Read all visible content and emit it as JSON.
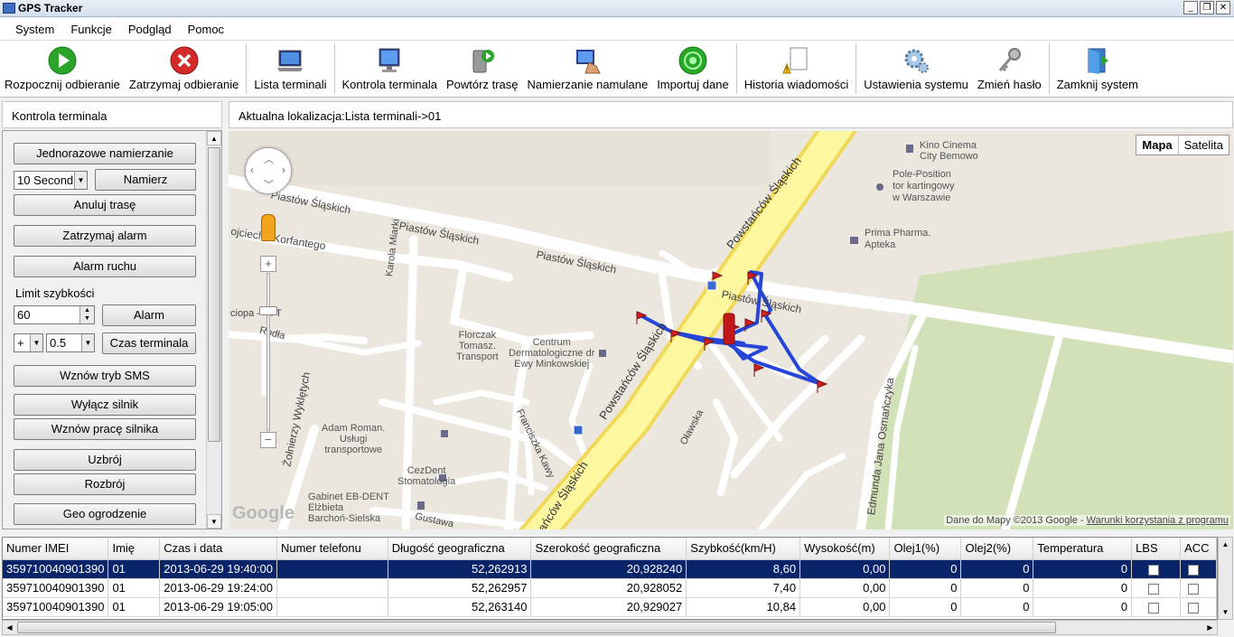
{
  "window": {
    "title": "GPS Tracker"
  },
  "menu": [
    "System",
    "Funkcje",
    "Podgląd",
    "Pomoc"
  ],
  "toolbar": {
    "start": "Rozpocznij odbieranie",
    "stop": "Zatrzymaj odbieranie",
    "terminal_list": "Lista terminali",
    "terminal_control": "Kontrola terminala",
    "replay": "Powtórz trasę",
    "locate": "Namierzanie namulane",
    "import": "Importuj dane",
    "history": "Historia wiadomości",
    "settings": "Ustawienia systemu",
    "password": "Zmień hasło",
    "close": "Zamknij system"
  },
  "left": {
    "header": "Kontrola terminala",
    "single_locate": "Jednorazowe namierzanie",
    "interval_value": "10 Second",
    "locate_btn": "Namierz",
    "cancel_route": "Anuluj trasę",
    "stop_alarm": "Zatrzymaj alarm",
    "motion_alarm": "Alarm ruchu",
    "speed_limit_label": "Limit szybkości",
    "speed_limit_value": "60",
    "alarm_btn": "Alarm",
    "tz_sign": "+",
    "tz_value": "0.5",
    "terminal_time": "Czas terminala",
    "resume_sms": "Wznów tryb SMS",
    "engine_off": "Wyłącz silnik",
    "engine_on": "Wznów pracę silnika",
    "arm": "Uzbrój",
    "disarm": "Rozbrój",
    "geofence": "Geo ogrodzenie"
  },
  "location": {
    "text": "Aktualna lokalizacja:Lista terminali->01"
  },
  "map": {
    "type_map": "Mapa",
    "type_satellite": "Satelita",
    "logo": "Google",
    "copyright": "Dane do Mapy ©2013 Google -",
    "terms": "Warunki korzystania z programu",
    "streets": {
      "piastow1": "Piastów Śląskich",
      "piastow2": "Piastów Śląskich",
      "piastow3": "Piastów Śląskich",
      "piastow4": "Piastów Śląskich",
      "powst1": "Powstańców Śląskich",
      "powst2": "Powstańców Śląskich",
      "powst3": "wstańców Śląskich",
      "korfantego": "ojciecha Korfantego",
      "karola": "Karola Miarki",
      "rodla": "Rodła",
      "zolnierzy": "Żołnierzy Wyklętych",
      "franciszka": "Franciszka Kawy",
      "olawska": "Oławska",
      "edmunda": "Edmunda Jana Osmańczyka",
      "gustawa": "Gustawa",
      "ciopa": "ciopa – el T"
    },
    "pois": {
      "kino": "Kino Cinema\nCity Bemowo",
      "pole": "Pole-Position\ntor kartingowy\nw Warszawie",
      "prima": "Prima Pharma.\nApteka",
      "florczak": "Florczak\nTomasz.\nTransport",
      "centrum": "Centrum\nDermatologiczne dr\nEwy Minkowskiej",
      "adam": "Adam Roman.\nUsługi\ntransportowe",
      "cezdent": "CezDent\nStomatologia",
      "gabinet": "Gabinet EB-DENT\nElżbieta\nBarchoń-Sielska"
    }
  },
  "table": {
    "columns": [
      "Numer IMEI",
      "Imię",
      "Czas i data",
      "Numer telefonu",
      "Długość geograficzna",
      "Szerokość geograficzna",
      "Szybkość(km/H)",
      "Wysokość(m)",
      "Olej1(%)",
      "Olej2(%)",
      "Temperatura",
      "LBS",
      "ACC"
    ],
    "rows": [
      [
        "359710040901390",
        "01",
        "2013-06-29 19:40:00",
        "",
        "52,262913",
        "20,928240",
        "8,60",
        "0,00",
        "0",
        "0",
        "0"
      ],
      [
        "359710040901390",
        "01",
        "2013-06-29 19:24:00",
        "",
        "52,262957",
        "20,928052",
        "7,40",
        "0,00",
        "0",
        "0",
        "0"
      ],
      [
        "359710040901390",
        "01",
        "2013-06-29 19:05:00",
        "",
        "52,263140",
        "20,929027",
        "10,84",
        "0,00",
        "0",
        "0",
        "0"
      ]
    ]
  }
}
